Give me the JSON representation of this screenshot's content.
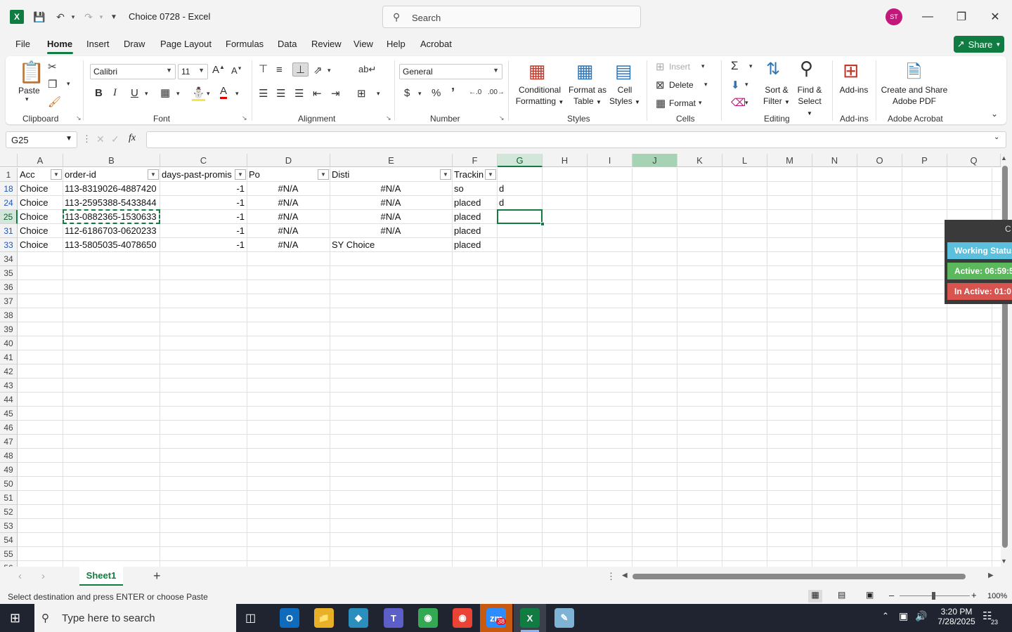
{
  "window": {
    "title": "Choice 0728  -  Excel",
    "search_placeholder": "Search",
    "avatar_initials": "ST"
  },
  "menu": {
    "tabs": [
      "File",
      "Home",
      "Insert",
      "Draw",
      "Page Layout",
      "Formulas",
      "Data",
      "Review",
      "View",
      "Help",
      "Acrobat"
    ],
    "share_label": "Share"
  },
  "ribbon": {
    "clipboard": {
      "paste": "Paste",
      "label": "Clipboard"
    },
    "font": {
      "name": "Calibri",
      "size": "11",
      "label": "Font"
    },
    "alignment": {
      "label": "Alignment"
    },
    "number": {
      "format": "General",
      "label": "Number"
    },
    "styles": {
      "conditional_1": "Conditional",
      "conditional_2": "Formatting",
      "format_table_1": "Format as",
      "format_table_2": "Table",
      "cell_styles_1": "Cell",
      "cell_styles_2": "Styles",
      "label": "Styles"
    },
    "cells": {
      "insert": "Insert",
      "delete": "Delete",
      "format": "Format",
      "label": "Cells"
    },
    "editing": {
      "sort_1": "Sort &",
      "sort_2": "Filter",
      "find_1": "Find &",
      "find_2": "Select",
      "label": "Editing"
    },
    "addins": {
      "btn": "Add-ins",
      "label": "Add-ins"
    },
    "acrobat": {
      "btn_1": "Create and Share",
      "btn_2": "Adobe PDF",
      "label": "Adobe Acrobat"
    }
  },
  "formula_bar": {
    "name_box": "G25",
    "formula": ""
  },
  "grid": {
    "columns": [
      "A",
      "B",
      "C",
      "D",
      "E",
      "F",
      "G",
      "H",
      "I",
      "J",
      "K",
      "L",
      "M",
      "N",
      "O",
      "P",
      "Q"
    ],
    "header_row": {
      "row_num": "1",
      "A": "Acc",
      "B": "order-id",
      "C": "days-past-promis",
      "D": "Po",
      "E": "Disti",
      "F": "Trackin"
    },
    "rows": [
      {
        "num": "18",
        "A": "Choice",
        "B": "113-8319026-4887420",
        "C": "-1",
        "D": "#N/A",
        "E": "#N/A",
        "F": "so",
        "G": "d"
      },
      {
        "num": "24",
        "A": "Choice",
        "B": "113-2595388-5433844",
        "C": "-1",
        "D": "#N/A",
        "E": "#N/A",
        "F": "placed",
        "G": "d"
      },
      {
        "num": "25",
        "A": "Choice",
        "B": "113-0882365-1530633",
        "C": "-1",
        "D": "#N/A",
        "E": "#N/A",
        "F": "placed",
        "G": ""
      },
      {
        "num": "31",
        "A": "Choice",
        "B": "112-6186703-0620233",
        "C": "-1",
        "D": "#N/A",
        "E": "#N/A",
        "F": "placed",
        "G": ""
      },
      {
        "num": "33",
        "A": "Choice",
        "B": "113-5805035-4078650",
        "C": "-1",
        "D": "#N/A",
        "E": "SY Choice",
        "F": "placed",
        "G": ""
      }
    ],
    "empty_rows": [
      "34",
      "35",
      "36",
      "37",
      "38",
      "39",
      "40",
      "41",
      "42",
      "43",
      "44",
      "45",
      "46",
      "47",
      "48",
      "49",
      "50",
      "51",
      "52",
      "53",
      "54",
      "55",
      "56"
    ]
  },
  "sheet_tabs": {
    "active": "Sheet1"
  },
  "status": {
    "message": "Select destination and press ENTER or choose Paste",
    "zoom": "100%"
  },
  "widget": {
    "title": "Working Status",
    "active": "Active: 06:59:5",
    "inactive": "In Active: 01:0"
  },
  "taskbar": {
    "search_placeholder": "Type here to search",
    "time": "3:20 PM",
    "date": "7/28/2025",
    "notif_count": "23",
    "zoom_badge": "38"
  },
  "colors": {
    "excel_green": "#107c41",
    "active_green": "#5cb85c",
    "inactive_red": "#d9534f",
    "working_teal": "#5bc0de"
  }
}
